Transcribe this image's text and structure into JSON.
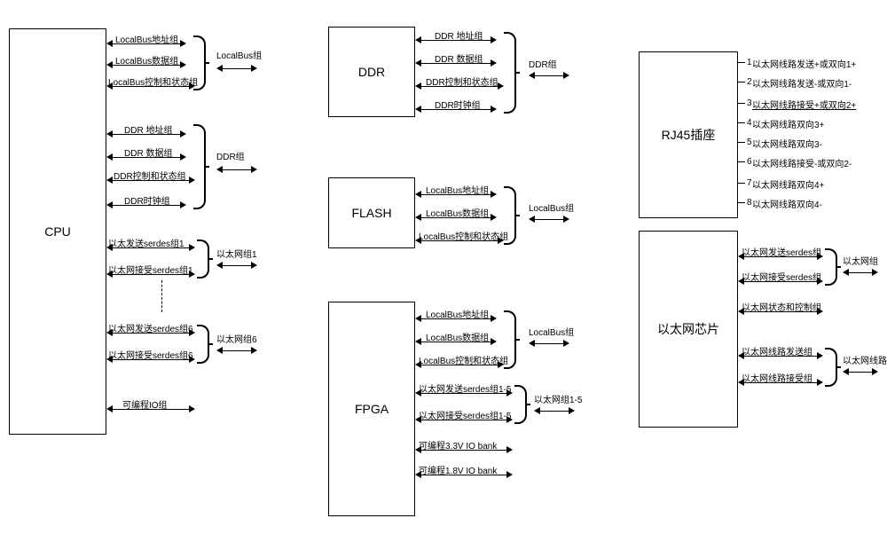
{
  "blocks": {
    "cpu": "CPU",
    "ddr": "DDR",
    "flash": "FLASH",
    "fpga": "FPGA",
    "rj45": "RJ45插座",
    "ethchip": "以太网芯片"
  },
  "cpu": {
    "lb_addr": "LocalBus地址组",
    "lb_data": "LocalBus数据组",
    "lb_ctrl": "LocalBus控制和状态组",
    "lb_group": "LocalBus组",
    "ddr_addr": "DDR 地址组",
    "ddr_data": "DDR 数据组",
    "ddr_ctrl": "DDR控制和状态组",
    "ddr_clk": "DDR时钟组",
    "ddr_group": "DDR组",
    "eth_tx1": "以太发送serdes组1",
    "eth_rx1": "以太网接受serdes组1",
    "eth_g1": "以太网组1",
    "eth_tx6": "以太网发送serdes组6",
    "eth_rx6": "以太网接受serdes组6",
    "eth_g6": "以太网组6",
    "pio": "可编程IO组"
  },
  "ddr": {
    "addr": "DDR 地址组",
    "data": "DDR 数据组",
    "ctrl": "DDR控制和状态组",
    "clk": "DDR时钟组",
    "group": "DDR组"
  },
  "flash": {
    "lb_addr": "LocalBus地址组",
    "lb_data": "LocalBus数据组",
    "lb_ctrl": "LocalBus控制和状态组",
    "lb_group": "LocalBus组"
  },
  "fpga": {
    "lb_addr": "LocalBus地址组",
    "lb_data": "LocalBus数据组",
    "lb_ctrl": "LocalBus控制和状态组",
    "lb_group": "LocalBus组",
    "eth_tx": "以太网发送serdes组1-5",
    "eth_rx": "以太网接受serdes组1-5",
    "eth_group": "以太网组1-5",
    "io33": "可编程3.3V IO bank",
    "io18": "可编程1.8V IO bank"
  },
  "rj45": {
    "p1": "以太网线路发送+或双向1+",
    "p2": "以太网线路发送-或双向1-",
    "p3": "以太网线路接受+或双向2+",
    "p4": "以太网线路双向3+",
    "p5": "以太网线路双向3-",
    "p6": "以太网线路接受-或双向2-",
    "p7": "以太网线路双向4+",
    "p8": "以太网线路双向4-"
  },
  "ethchip": {
    "tx_serdes": "以太网发送serdes组",
    "rx_serdes": "以太网接受serdes组",
    "stat": "以太网状态和控制组",
    "group": "以太网组",
    "line_tx": "以太网线路发送组",
    "line_rx": "以太网线路接受组",
    "line_group": "以太网线路组"
  },
  "chart_data": {
    "type": "block-diagram",
    "nodes": [
      {
        "id": "CPU",
        "ports": [
          "LocalBus地址组",
          "LocalBus数据组",
          "LocalBus控制和状态组",
          "DDR 地址组",
          "DDR 数据组",
          "DDR控制和状态组",
          "DDR时钟组",
          "以太发送serdes组1",
          "以太网接受serdes组1",
          "以太网发送serdes组6",
          "以太网接受serdes组6",
          "可编程IO组"
        ],
        "grouped": [
          "LocalBus组",
          "DDR组",
          "以太网组1",
          "以太网组6"
        ]
      },
      {
        "id": "DDR",
        "ports": [
          "DDR 地址组",
          "DDR 数据组",
          "DDR控制和状态组",
          "DDR时钟组"
        ],
        "grouped": [
          "DDR组"
        ]
      },
      {
        "id": "FLASH",
        "ports": [
          "LocalBus地址组",
          "LocalBus数据组",
          "LocalBus控制和状态组"
        ],
        "grouped": [
          "LocalBus组"
        ]
      },
      {
        "id": "FPGA",
        "ports": [
          "LocalBus地址组",
          "LocalBus数据组",
          "LocalBus控制和状态组",
          "以太网发送serdes组1-5",
          "以太网接受serdes组1-5",
          "可编程3.3V IO bank",
          "可编程1.8V IO bank"
        ],
        "grouped": [
          "LocalBus组",
          "以太网组1-5"
        ]
      },
      {
        "id": "RJ45插座",
        "pins": [
          "以太网线路发送+或双向1+",
          "以太网线路发送-或双向1-",
          "以太网线路接受+或双向2+",
          "以太网线路双向3+",
          "以太网线路双向3-",
          "以太网线路接受-或双向2-",
          "以太网线路双向4+",
          "以太网线路双向4-"
        ]
      },
      {
        "id": "以太网芯片",
        "ports": [
          "以太网发送serdes组",
          "以太网接受serdes组",
          "以太网状态和控制组",
          "以太网线路发送组",
          "以太网线路接受组"
        ],
        "grouped": [
          "以太网组",
          "以太网线路组"
        ]
      }
    ]
  }
}
